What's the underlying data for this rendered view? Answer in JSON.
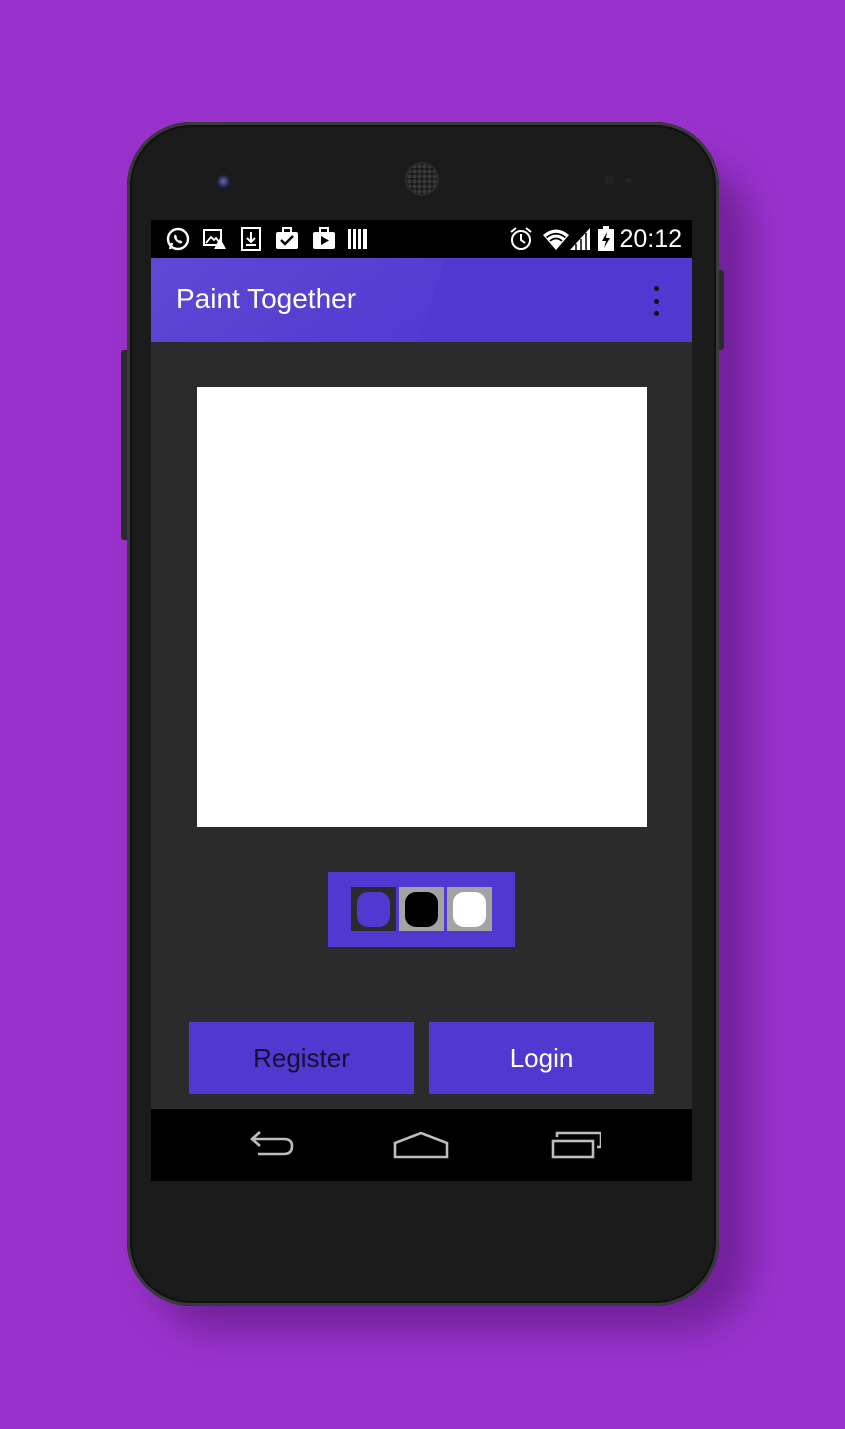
{
  "app": {
    "title": "Paint Together"
  },
  "status_bar": {
    "time": "20:12",
    "left_icons": [
      "whatsapp-icon",
      "image-warning-icon",
      "download-icon",
      "briefcase-check-icon",
      "play-store-icon",
      "barcode-icon"
    ],
    "right_icons": [
      "alarm-icon",
      "wifi-icon",
      "signal-icon",
      "battery-charging-icon"
    ]
  },
  "palette": {
    "colors": [
      "#5138d1",
      "#000000",
      "#ffffff"
    ],
    "selected_index": 0
  },
  "actions": {
    "register_label": "Register",
    "login_label": "Login"
  },
  "navigation": {
    "buttons": [
      "back-icon",
      "home-icon",
      "recents-icon"
    ]
  },
  "colors": {
    "background": "#9932cc",
    "accent": "#5138d1",
    "screen": "#2b2b2b",
    "canvas": "#ffffff"
  }
}
